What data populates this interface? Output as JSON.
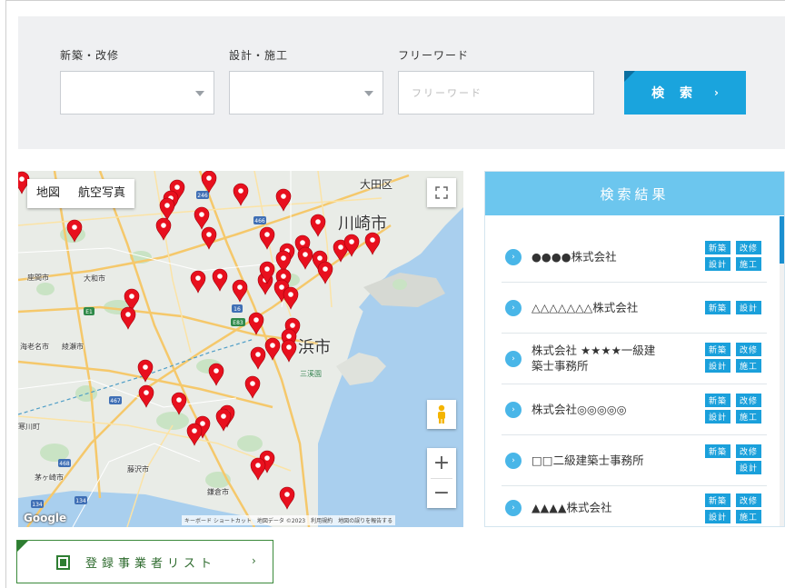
{
  "search": {
    "field1_label": "新築・改修",
    "field2_label": "設計・施工",
    "field3_label": "フリーワード",
    "freeword_placeholder": "フリーワード",
    "search_button": "検 索",
    "search_chevron": "›"
  },
  "map": {
    "tab_map": "地図",
    "tab_satellite": "航空写真",
    "footer": "キーボード ショートカット　地図データ ©2023　利用規約　地図の誤りを報告する",
    "logo": "Google",
    "cities": {
      "ota": "大田区",
      "kawasaki": "川崎市",
      "yokohama": "浜市",
      "sanmaeen": "三溪園",
      "zama": "座間市",
      "yamato": "大和市",
      "ebina": "海老名市",
      "ayase": "綾瀬市",
      "samukawa": "寒川町",
      "fujisawa": "藤沢市",
      "kamakura": "鎌倉市",
      "chigasaki": "茅ヶ崎市"
    },
    "road_numbers": [
      "246",
      "466",
      "16",
      "E83",
      "E1",
      "467",
      "134",
      "134",
      "468"
    ],
    "marker_color": "#e8101e"
  },
  "results": {
    "header": "検索結果",
    "items": [
      {
        "name": "●●●●株式会社",
        "tags": [
          "新築",
          "改修",
          "設計",
          "施工"
        ]
      },
      {
        "name": "△△△△△△△株式会社",
        "tags": [
          "新築",
          "設計"
        ]
      },
      {
        "name_line1": "株式会社 ★★★★一級建",
        "name_line2": "築士事務所",
        "tags": [
          "新築",
          "改修",
          "設計",
          "施工"
        ]
      },
      {
        "name": "株式会社◎◎◎◎◎",
        "tags": [
          "新築",
          "改修",
          "設計",
          "施工"
        ]
      },
      {
        "name": "□□二級建築士事務所",
        "tags": [
          "新築",
          "改修",
          "設計"
        ]
      },
      {
        "name": "▲▲▲▲株式会社",
        "tags": [
          "新築",
          "改修",
          "設計",
          "施工"
        ]
      }
    ],
    "arrow": "›"
  },
  "list_button": {
    "label": "登録事業者リスト",
    "chevron": "›"
  }
}
